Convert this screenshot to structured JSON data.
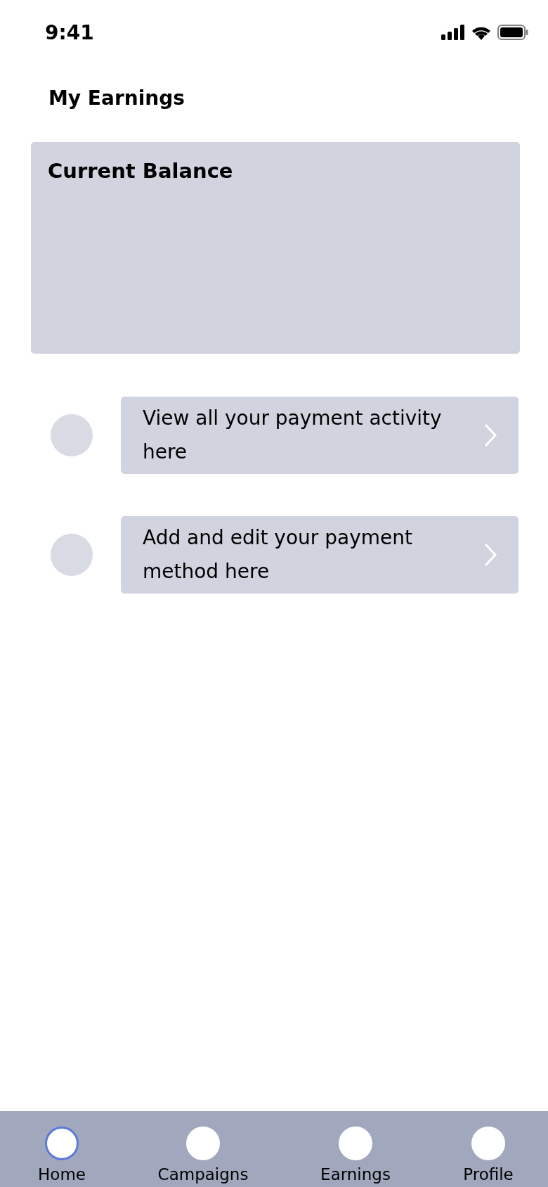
{
  "status_bar": {
    "time": "9:41"
  },
  "header": {
    "title": "My Earnings"
  },
  "balance_card": {
    "title": "Current Balance"
  },
  "actions": [
    {
      "label": "View all your payment activity here"
    },
    {
      "label": "Add and edit your payment method here"
    }
  ],
  "nav": [
    {
      "label": "Home",
      "selected": true
    },
    {
      "label": "Campaigns",
      "selected": false
    },
    {
      "label": "Earnings",
      "selected": false
    },
    {
      "label": "Profile",
      "selected": false
    }
  ]
}
